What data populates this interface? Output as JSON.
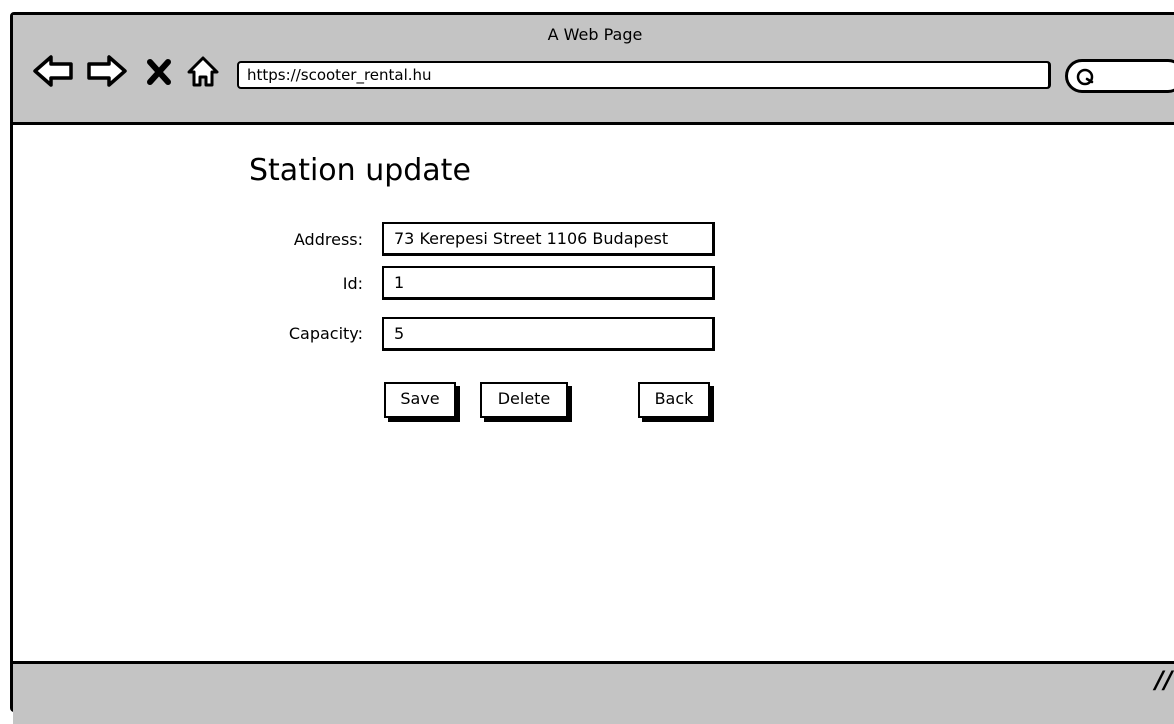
{
  "window": {
    "title": "A Web Page"
  },
  "toolbar": {
    "icons": [
      "back-arrow-icon",
      "forward-arrow-icon",
      "close-icon",
      "home-icon",
      "search-icon"
    ],
    "url": "https://scooter_rental.hu"
  },
  "page": {
    "title": "Station update",
    "fields": [
      {
        "label": "Address:",
        "value": "73 Kerepesi Street 1106 Budapest"
      },
      {
        "label": "Id:",
        "value": "1"
      },
      {
        "label": "Capacity:",
        "value": "5"
      }
    ],
    "buttons": {
      "save": "Save",
      "delete": "Delete",
      "back": "Back"
    }
  },
  "status_bar": {
    "grip": "//"
  },
  "colors": {
    "chrome": "#c4c4c4",
    "border": "#000000",
    "background": "#ffffff"
  }
}
